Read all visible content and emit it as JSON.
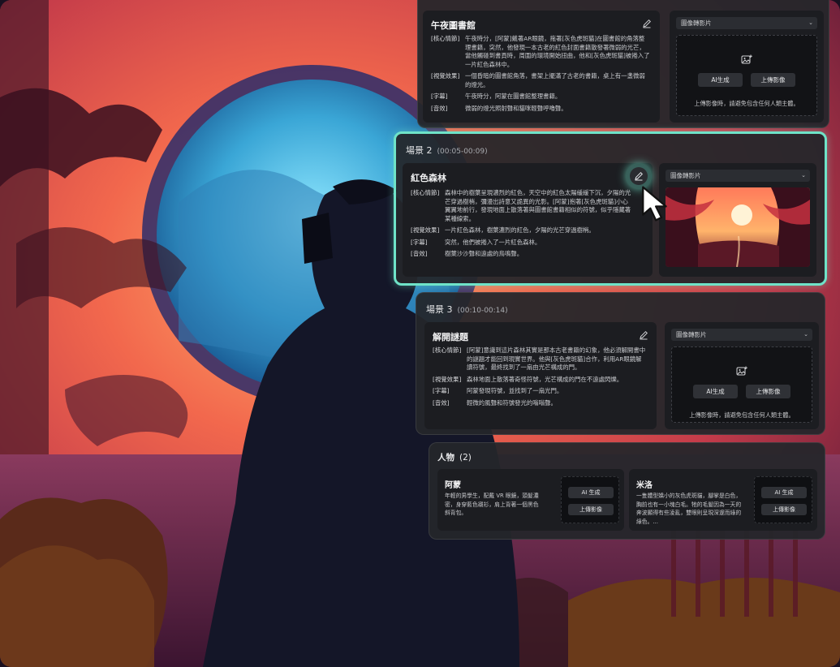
{
  "scene_top": {
    "title": "午夜圖書館",
    "rows": [
      {
        "k": "[核心情節]",
        "v": "午夜時分，[阿蒙]戴著AR眼鏡，拖著[灰色虎斑貓]在圖書館的角落整理書籍，突然，他發現一本古老的紅色封面書籍散發著微弱的光芒，當他觸碰到書頁時，周圍的環境開始扭曲，他和[灰色虎斑貓]被捲入了一片紅色森林中。"
      },
      {
        "k": "[視覺效果]",
        "v": "一個昏暗的圖書館角落，書架上擺滿了古老的書籍，桌上有一盞微弱的燈光。"
      },
      {
        "k": "[字幕]",
        "v": "午夜時分，阿蒙在圖書館整理書籍。"
      },
      {
        "k": "[音效]",
        "v": "微弱的燈光照射聲和貓咪輕聲呼嚕聲。"
      }
    ],
    "media_select": "圖像轉影片",
    "ai_btn": "AI生成",
    "upload_btn": "上傳影像",
    "note": "上傳影像時，請避免包含任何人類主體。"
  },
  "scene2": {
    "label": "場景 2",
    "time": "(00:05-00:09)",
    "title": "紅色森林",
    "rows": [
      {
        "k": "[核心情節]",
        "v": "森林中的樹葉呈現濃烈的紅色，天空中的紅色太陽緩緩下沉，夕陽的光芒穿過樹梢，彌漫出詩意又詭異的光影。[阿蒙]抱著[灰色虎斑貓]小心翼翼地前行，發現地面上散落著與圖書館書籍相似的符號，似乎隱藏著某種線索。"
      },
      {
        "k": "[視覺效果]",
        "v": "一片紅色森林，樹葉濃烈的紅色，夕陽的光芒穿過樹梢。"
      },
      {
        "k": "[字幕]",
        "v": "突然，他們被捲入了一片紅色森林。"
      },
      {
        "k": "[音效]",
        "v": "樹葉沙沙聲和遠處的鳥鳴聲。"
      }
    ],
    "media_select": "圖像轉影片"
  },
  "scene3": {
    "label": "場景 3",
    "time": "(00:10-00:14)",
    "title": "解開謎題",
    "rows": [
      {
        "k": "[核心情節]",
        "v": "[阿蒙]意識到這片森林其實是那本古老書籍的幻象，他必須解開書中的謎題才能回到現實世界。他與[灰色虎斑貓]合作，利用AR眼鏡解讀符號，最終找到了一扇由光芒構成的門。"
      },
      {
        "k": "[視覺效果]",
        "v": "森林地面上散落著奇怪符號，光芒構成的門在不遠處閃爍。"
      },
      {
        "k": "[字幕]",
        "v": "阿蒙發現符號，並找到了一扇光門。"
      },
      {
        "k": "[音效]",
        "v": "輕微的風聲和符號發光的嗡嗡聲。"
      }
    ],
    "media_select": "圖像轉影片",
    "ai_btn": "AI生成",
    "upload_btn": "上傳影像",
    "note": "上傳影像時，請避免包含任何人類主體。"
  },
  "characters": {
    "title": "人物",
    "count": "(2)",
    "items": [
      {
        "name": "阿蒙",
        "desc": "年輕的男學生，配戴 VR 眼鏡，頭髮濃密，身穿藍色襯衫，肩上背著一個黑色斜背包。",
        "ai_btn": "AI 生成",
        "upload_btn": "上傳影像"
      },
      {
        "name": "米洛",
        "desc": "一隻體型嬌小的灰色虎斑貓，腳掌是白色，胸前也有一小塊白毛。牠的毛髮因為一天的奔波顯得有些凌亂，雙眼則呈現深邃而綠的綠色。...",
        "ai_btn": "AI 生成",
        "upload_btn": "上傳影像"
      }
    ]
  },
  "colors": {
    "accent": "#6fe3c8",
    "panel": "#24262a",
    "card": "#1c1d21"
  }
}
